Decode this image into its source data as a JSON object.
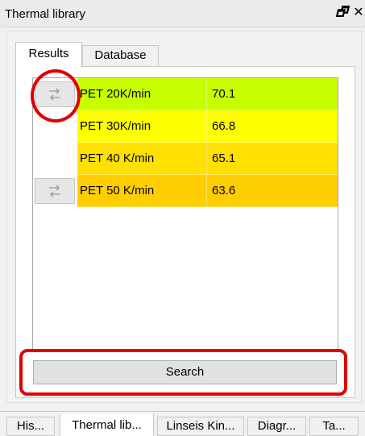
{
  "window": {
    "title": "Thermal library",
    "float_glyph": "🗗",
    "close_glyph": "✕"
  },
  "tabs": [
    "Results",
    "Database"
  ],
  "results": [
    {
      "name": "PET 20K/min",
      "value": "70.1",
      "color": "#c8ff00",
      "has_button": true
    },
    {
      "name": "PET 30K/min",
      "value": "66.8",
      "color": "#ffff00",
      "has_button": false
    },
    {
      "name": "PET 40 K/min",
      "value": "65.1",
      "color": "#ffe000",
      "has_button": false
    },
    {
      "name": "PET 50 K/min",
      "value": "63.6",
      "color": "#ffce00",
      "has_button": true
    }
  ],
  "row_button_icon": "swap-arrows-icon",
  "search_label": "Search",
  "bottom_tabs": [
    "His...",
    "Thermal lib...",
    "Linseis Kin...",
    "Diagr...",
    "Ta..."
  ],
  "active_bottom_tab": 1,
  "highlight_color": "#e00000"
}
